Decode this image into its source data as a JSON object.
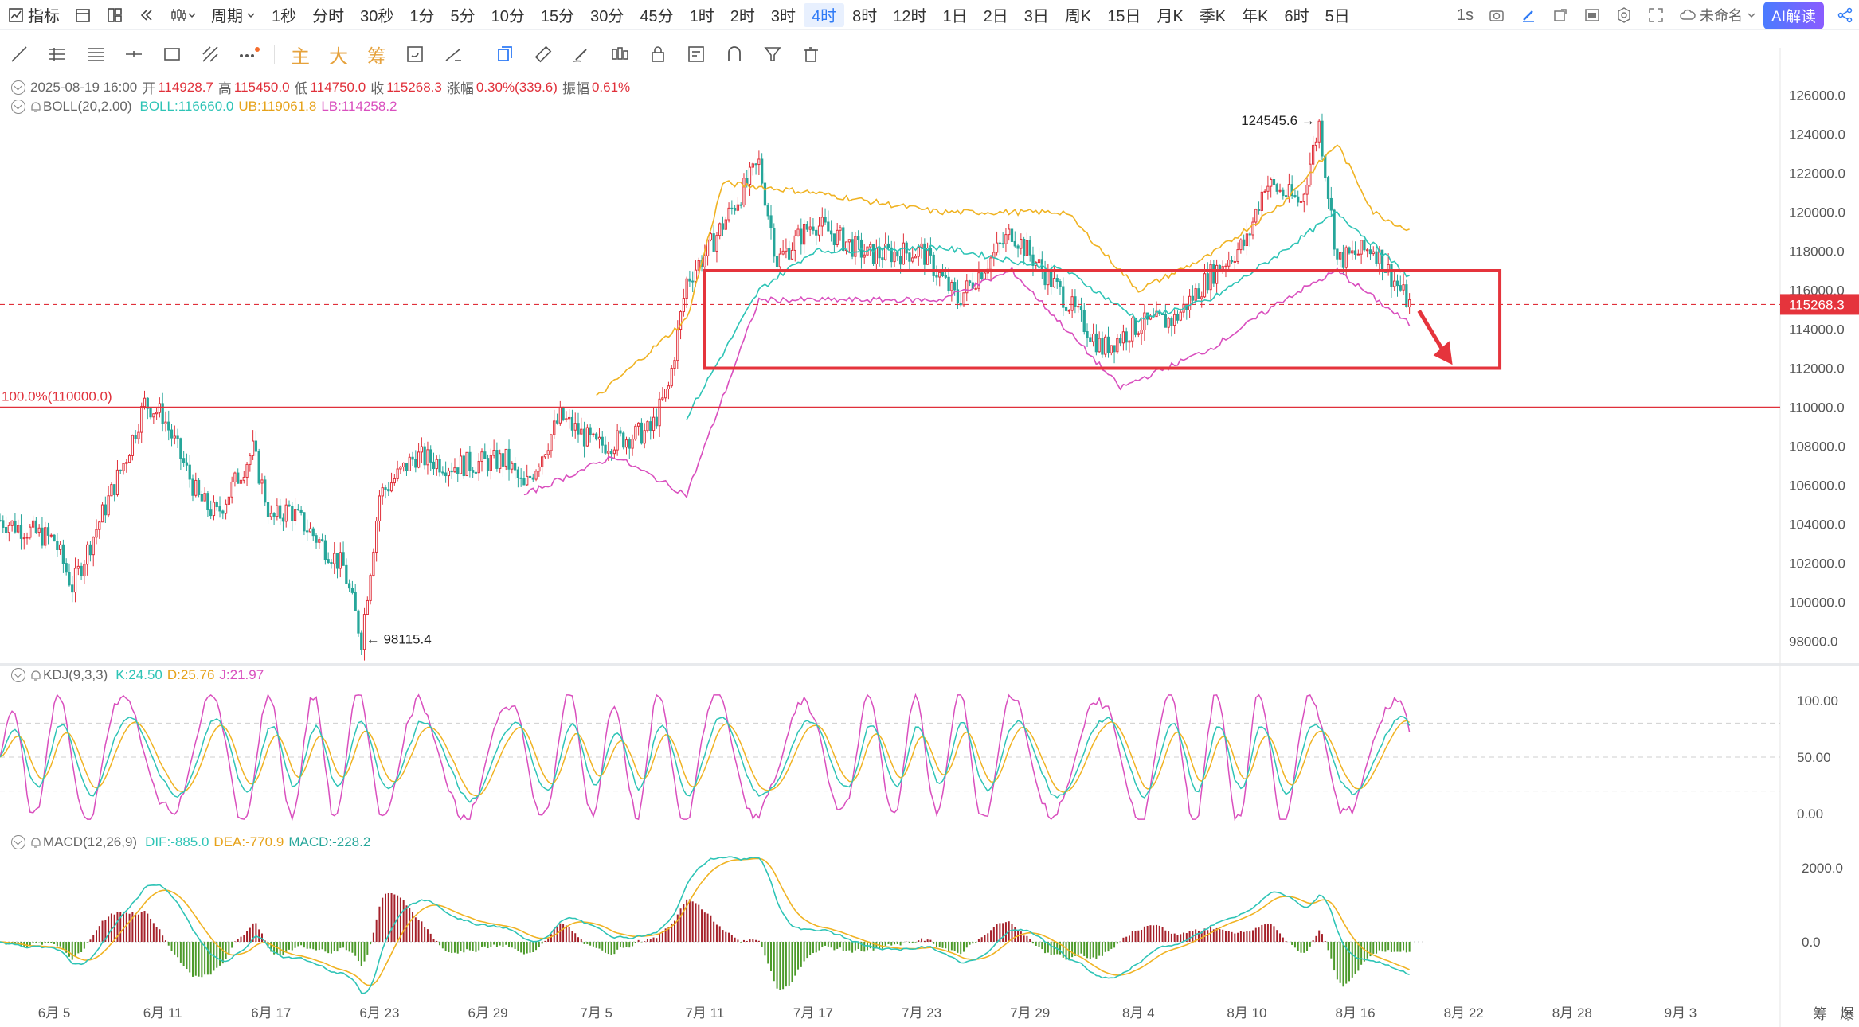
{
  "toolbar": {
    "indicator_label": "指标",
    "period_label": "周期",
    "periods": [
      "1秒",
      "分时",
      "30秒",
      "1分",
      "5分",
      "10分",
      "15分",
      "30分",
      "45分",
      "1时",
      "2时",
      "3时",
      "4时",
      "8时",
      "12时",
      "1日",
      "2日",
      "3日",
      "周K",
      "15日",
      "月K",
      "季K",
      "年K",
      "6时",
      "5日"
    ],
    "active_period": "4时",
    "realtime_label": "1s",
    "layout_name": "未命名",
    "ai_button": "AI解读"
  },
  "drawbar": {
    "text_tools": [
      "主",
      "大",
      "筹"
    ]
  },
  "ohlc": {
    "datetime": "2025-08-19 16:00",
    "open_label": "开",
    "open": "114928.7",
    "high_label": "高",
    "high": "115450.0",
    "low_label": "低",
    "low": "114750.0",
    "close_label": "收",
    "close": "115268.3",
    "change_label": "涨幅",
    "change": "0.30%(339.6)",
    "amplitude_label": "振幅",
    "amplitude": "0.61%"
  },
  "boll": {
    "name": "BOLL(20,2.00)",
    "mid": "BOLL:116660.0",
    "ub": "UB:119061.8",
    "lb": "LB:114258.2"
  },
  "kdj": {
    "name": "KDJ(9,3,3)",
    "k": "K:24.50",
    "d": "D:25.76",
    "j": "J:21.97"
  },
  "macd": {
    "name": "MACD(12,26,9)",
    "dif": "DIF:-885.0",
    "dea": "DEA:-770.9",
    "macd": "MACD:-228.2"
  },
  "price_axis": [
    "126000.0",
    "124000.0",
    "122000.0",
    "120000.0",
    "118000.0",
    "116000.0",
    "114000.0",
    "112000.0",
    "110000.0",
    "108000.0",
    "106000.0",
    "104000.0",
    "102000.0",
    "100000.0",
    "98000.0"
  ],
  "current_price_tag": "115268.3",
  "kdj_axis": [
    "100.00",
    "50.00",
    "0.00"
  ],
  "macd_axis": [
    "2000.0",
    "0.0"
  ],
  "date_axis": [
    "6月 5",
    "6月 11",
    "6月 17",
    "6月 23",
    "6月 29",
    "7月 5",
    "7月 11",
    "7月 17",
    "7月 23",
    "7月 29",
    "8月 4",
    "8月 10",
    "8月 16",
    "8月 22",
    "8月 28",
    "9月 3"
  ],
  "annotations": {
    "high_marker": "124545.6 →",
    "low_marker": "← 98115.4",
    "fib_level": "100.0%(110000.0)"
  },
  "bottom_right": [
    "筹",
    "爆"
  ],
  "colors": {
    "up": "#e0303a",
    "down": "#26a69a",
    "boll_mid": "#2ec4b6",
    "boll_ub": "#f0b323",
    "boll_lb": "#d94fbe",
    "accent": "#2f7bf6",
    "box": "#e5343c"
  },
  "chart_data": [
    {
      "type": "candlestick",
      "title": "",
      "indicators": [
        "BOLL(20,2.00)"
      ],
      "x_range": [
        "6月 2",
        "9月 6"
      ],
      "ylim": [
        97000,
        127000
      ],
      "swing_points": [
        {
          "date": "6月 2",
          "close": 104200
        },
        {
          "date": "6月 5",
          "close": 103200
        },
        {
          "date": "6月 6",
          "close": 100800
        },
        {
          "date": "6月 9",
          "close": 107500
        },
        {
          "date": "6月 10",
          "close": 110200
        },
        {
          "date": "6月 11",
          "close": 109600
        },
        {
          "date": "6月 13",
          "close": 105300
        },
        {
          "date": "6月 14",
          "close": 104500
        },
        {
          "date": "6月 16",
          "close": 107800
        },
        {
          "date": "6月 17",
          "close": 104200
        },
        {
          "date": "6月 18",
          "close": 104800
        },
        {
          "date": "6月 21",
          "close": 101800
        },
        {
          "date": "6月 22",
          "close": 98115
        },
        {
          "date": "6月 23",
          "close": 105500
        },
        {
          "date": "6月 25",
          "close": 107500
        },
        {
          "date": "6月 27",
          "close": 107000
        },
        {
          "date": "6月 30",
          "close": 107300
        },
        {
          "date": "7月 1",
          "close": 105800
        },
        {
          "date": "7月 3",
          "close": 109500
        },
        {
          "date": "7月 5",
          "close": 108000
        },
        {
          "date": "7月 8",
          "close": 108800
        },
        {
          "date": "7月 9",
          "close": 111000
        },
        {
          "date": "7月 10",
          "close": 116500
        },
        {
          "date": "7月 11",
          "close": 117800
        },
        {
          "date": "7月 14",
          "close": 122500
        },
        {
          "date": "7月 15",
          "close": 117500
        },
        {
          "date": "7月 17",
          "close": 119500
        },
        {
          "date": "7月 20",
          "close": 117800
        },
        {
          "date": "7月 23",
          "close": 118000
        },
        {
          "date": "7月 25",
          "close": 115500
        },
        {
          "date": "7月 28",
          "close": 119000
        },
        {
          "date": "7月 31",
          "close": 115500
        },
        {
          "date": "8月 2",
          "close": 113000
        },
        {
          "date": "8月 4",
          "close": 114200
        },
        {
          "date": "8月 6",
          "close": 114500
        },
        {
          "date": "8月 8",
          "close": 116800
        },
        {
          "date": "8月 10",
          "close": 118500
        },
        {
          "date": "8月 11",
          "close": 121500
        },
        {
          "date": "8月 13",
          "close": 120500
        },
        {
          "date": "8月 14",
          "close": 124545
        },
        {
          "date": "8月 15",
          "close": 117500
        },
        {
          "date": "8月 17",
          "close": 118200
        },
        {
          "date": "8月 19",
          "close": 115268
        }
      ],
      "boll_mid": [
        {
          "date": "7月 10",
          "value": 109500
        },
        {
          "date": "7月 14",
          "value": 116000
        },
        {
          "date": "7月 17",
          "value": 118000
        },
        {
          "date": "7月 24",
          "value": 118200
        },
        {
          "date": "7月 31",
          "value": 117000
        },
        {
          "date": "8月 4",
          "value": 114500
        },
        {
          "date": "8月 8",
          "value": 115500
        },
        {
          "date": "8月 12",
          "value": 118000
        },
        {
          "date": "8月 15",
          "value": 120000
        },
        {
          "date": "8月 19",
          "value": 116660
        }
      ],
      "boll_ub": [
        {
          "date": "7月 5",
          "value": 110500
        },
        {
          "date": "7月 10",
          "value": 114500
        },
        {
          "date": "7月 12",
          "value": 121500
        },
        {
          "date": "7月 17",
          "value": 121000
        },
        {
          "date": "7月 24",
          "value": 120000
        },
        {
          "date": "7月 31",
          "value": 120000
        },
        {
          "date": "8月 4",
          "value": 116000
        },
        {
          "date": "8月 8",
          "value": 117800
        },
        {
          "date": "8月 12",
          "value": 120500
        },
        {
          "date": "8月 15",
          "value": 123500
        },
        {
          "date": "8月 17",
          "value": 120000
        },
        {
          "date": "8月 19",
          "value": 119062
        }
      ],
      "boll_lb": [
        {
          "date": "7月 1",
          "value": 105500
        },
        {
          "date": "7月 6",
          "value": 107500
        },
        {
          "date": "7月 10",
          "value": 105500
        },
        {
          "date": "7月 14",
          "value": 115500
        },
        {
          "date": "7月 24",
          "value": 115500
        },
        {
          "date": "7月 28",
          "value": 117000
        },
        {
          "date": "8月 3",
          "value": 111000
        },
        {
          "date": "8月 8",
          "value": 113000
        },
        {
          "date": "8月 12",
          "value": 115500
        },
        {
          "date": "8月 15",
          "value": 117000
        },
        {
          "date": "8月 19",
          "value": 114258
        }
      ],
      "horizontal_lines": [
        {
          "value": 110000,
          "label": "100.0%(110000.0)"
        },
        {
          "value": 115268.3,
          "label": "115268.3",
          "style": "dashed"
        }
      ],
      "box": {
        "from": "7月 11",
        "to": "8月 24",
        "top": 117000,
        "bottom": 112000
      }
    },
    {
      "type": "line",
      "title": "",
      "series_names": [
        "K",
        "D",
        "J"
      ],
      "ylim": [
        0,
        100
      ],
      "last": {
        "K": 24.5,
        "D": 25.76,
        "J": 21.97
      },
      "reference_lines": [
        80,
        50,
        20
      ]
    },
    {
      "type": "bar",
      "title": "",
      "series_names": [
        "DIF",
        "DEA",
        "MACD"
      ],
      "ylim": [
        -1000,
        2200
      ],
      "last": {
        "DIF": -885.0,
        "DEA": -770.9,
        "MACD": -228.2
      },
      "peak": {
        "date": "7月 12",
        "DIF": 2150
      }
    }
  ]
}
